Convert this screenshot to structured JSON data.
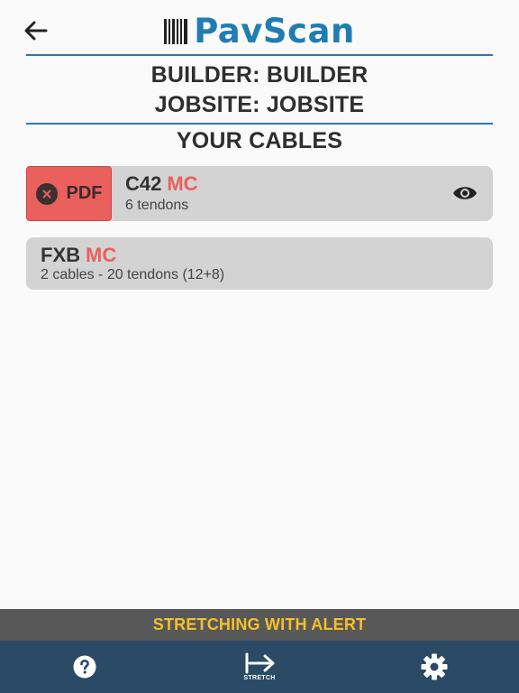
{
  "header": {
    "back_icon": "arrow-left-icon",
    "logo_text": "PavScan",
    "logo_color": "#1f7db3"
  },
  "info": {
    "builder": "BUILDER: BUILDER",
    "jobsite": "JOBSITE: JOBSITE",
    "section_title": "YOUR CABLES"
  },
  "cables": [
    {
      "name": "C42",
      "tag": "MC",
      "detail": "6 tendons",
      "pdf_label": "PDF",
      "has_pdf": true,
      "view_icon": "eye-icon"
    },
    {
      "name": "FXB",
      "tag": "MC",
      "detail": "2 cables - 20 tendons (12+8)",
      "has_pdf": false
    }
  ],
  "alert": {
    "text": "STRETCHING WITH ALERT",
    "color": "#f5c02a"
  },
  "tabbar": {
    "help_icon": "question-circle-icon",
    "stretch_icon": "stretch-arrow-icon",
    "stretch_label": "STRETCH",
    "settings_icon": "gear-icon"
  },
  "colors": {
    "accent_red": "#e9605c",
    "rule_blue": "#2a7aad",
    "tabbar_bg": "#2b4a66"
  }
}
